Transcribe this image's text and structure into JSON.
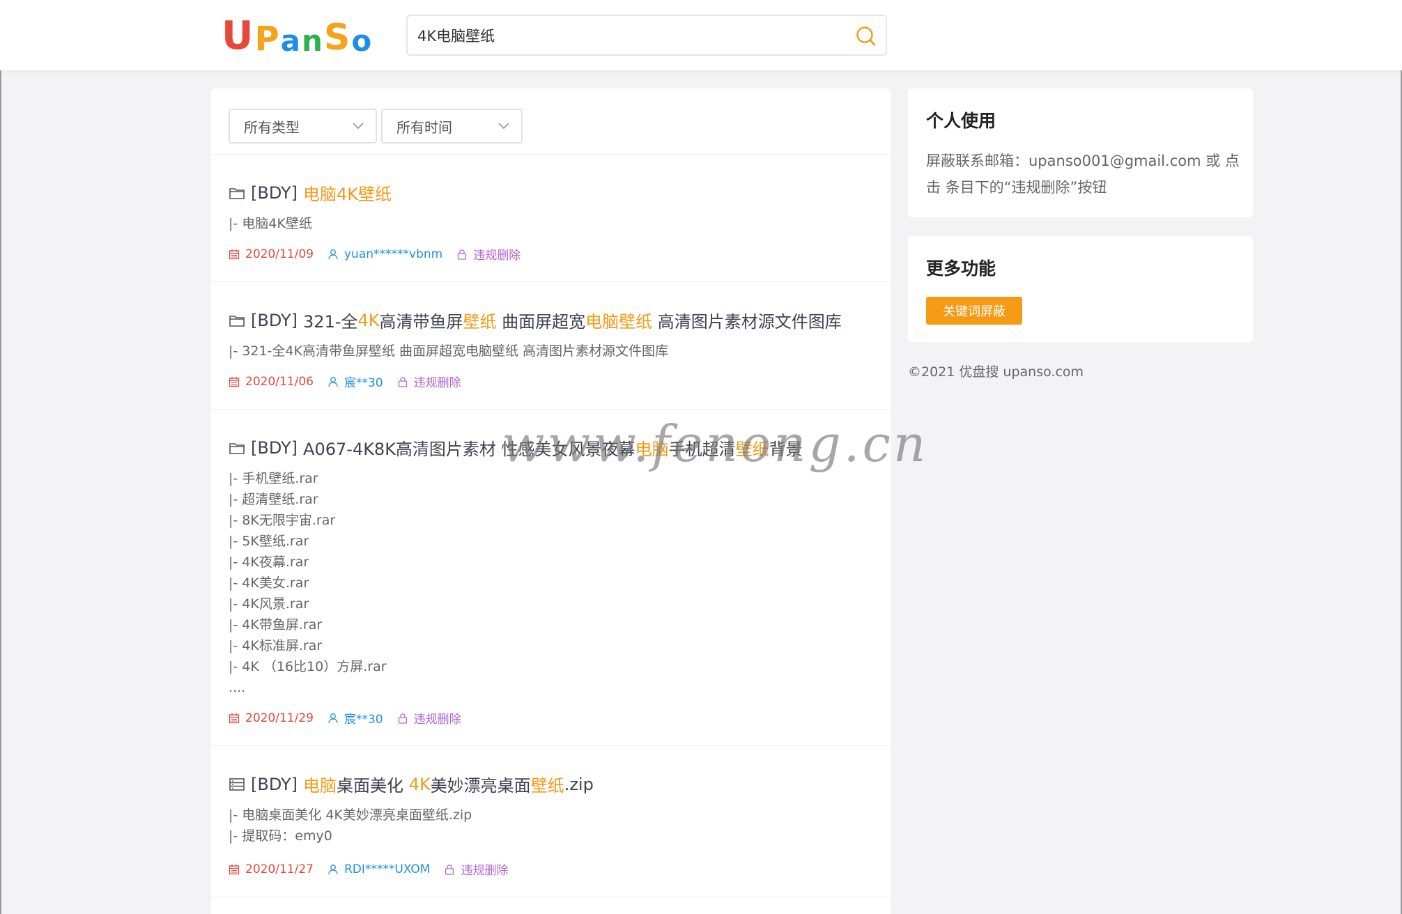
{
  "header": {
    "logo_letters": [
      "U",
      "P",
      "a",
      "n",
      "S",
      "o"
    ],
    "search": {
      "value": "4K电脑壁纸"
    }
  },
  "filters": {
    "type_label": "所有类型",
    "time_label": "所有时间"
  },
  "results": [
    {
      "icon": "folder-icon",
      "tag": "[BDY]",
      "title_parts": [
        {
          "t": "电脑4K壁纸",
          "hl": true
        }
      ],
      "files": [
        "|- 电脑4K壁纸"
      ],
      "date": "2020/11/09",
      "user": "yuan******vbnm",
      "report": "违规删除"
    },
    {
      "icon": "folder-icon",
      "tag": "[BDY]",
      "title_parts": [
        {
          "t": "321-全",
          "hl": false
        },
        {
          "t": "4K",
          "hl": true
        },
        {
          "t": "高清带鱼屏",
          "hl": false
        },
        {
          "t": "壁纸",
          "hl": true
        },
        {
          "t": " 曲面屏超宽",
          "hl": false
        },
        {
          "t": "电脑壁纸",
          "hl": true
        },
        {
          "t": " 高清图片素材源文件图库",
          "hl": false
        }
      ],
      "files": [
        "|- 321-全4K高清带鱼屏壁纸 曲面屏超宽电脑壁纸 高清图片素材源文件图库"
      ],
      "date": "2020/11/06",
      "user": "宸**30",
      "report": "违规删除"
    },
    {
      "icon": "folder-icon",
      "tag": "[BDY]",
      "title_parts": [
        {
          "t": "A067-4K8K高清图片素材 性感美女风景夜幕",
          "hl": false
        },
        {
          "t": "电脑",
          "hl": true
        },
        {
          "t": "手机超清",
          "hl": false
        },
        {
          "t": "壁纸",
          "hl": true
        },
        {
          "t": "背景",
          "hl": false
        }
      ],
      "files": [
        "|- 手机壁纸.rar",
        "|- 超清壁纸.rar",
        "|- 8K无限宇宙.rar",
        "|- 5K壁纸.rar",
        "|- 4K夜幕.rar",
        "|- 4K美女.rar",
        "|- 4K风景.rar",
        "|- 4K带鱼屏.rar",
        "|- 4K标准屏.rar",
        "|- 4K （16比10）方屏.rar",
        "...."
      ],
      "date": "2020/11/29",
      "user": "宸**30",
      "report": "违规删除"
    },
    {
      "icon": "archive-icon",
      "tag": "[BDY]",
      "title_parts": [
        {
          "t": "电脑",
          "hl": true
        },
        {
          "t": "桌面美化 ",
          "hl": false
        },
        {
          "t": "4K",
          "hl": true
        },
        {
          "t": "美妙漂亮桌面",
          "hl": false
        },
        {
          "t": "壁纸",
          "hl": true
        },
        {
          "t": ".zip",
          "hl": false
        }
      ],
      "files": [
        "|- 电脑桌面美化 4K美妙漂亮桌面壁纸.zip",
        "|- 提取码：emy0"
      ],
      "date": "2020/11/27",
      "user": "RDI*****UXOM",
      "report": "违规删除"
    }
  ],
  "sidebar": {
    "personal": {
      "title": "个人使用",
      "text": "屏蔽联系邮箱：upanso001@gmail.com 或 点击 条目下的“违规删除”按钮"
    },
    "more": {
      "title": "更多功能",
      "button": "关键词屏蔽"
    },
    "copyright": "©2021 优盘搜 upanso.com"
  },
  "watermark": "www.fenong.cn",
  "colors": {
    "highlight": "#f59a16",
    "date": "#e0493b",
    "user": "#1e8fe6",
    "report": "#b266d1"
  }
}
